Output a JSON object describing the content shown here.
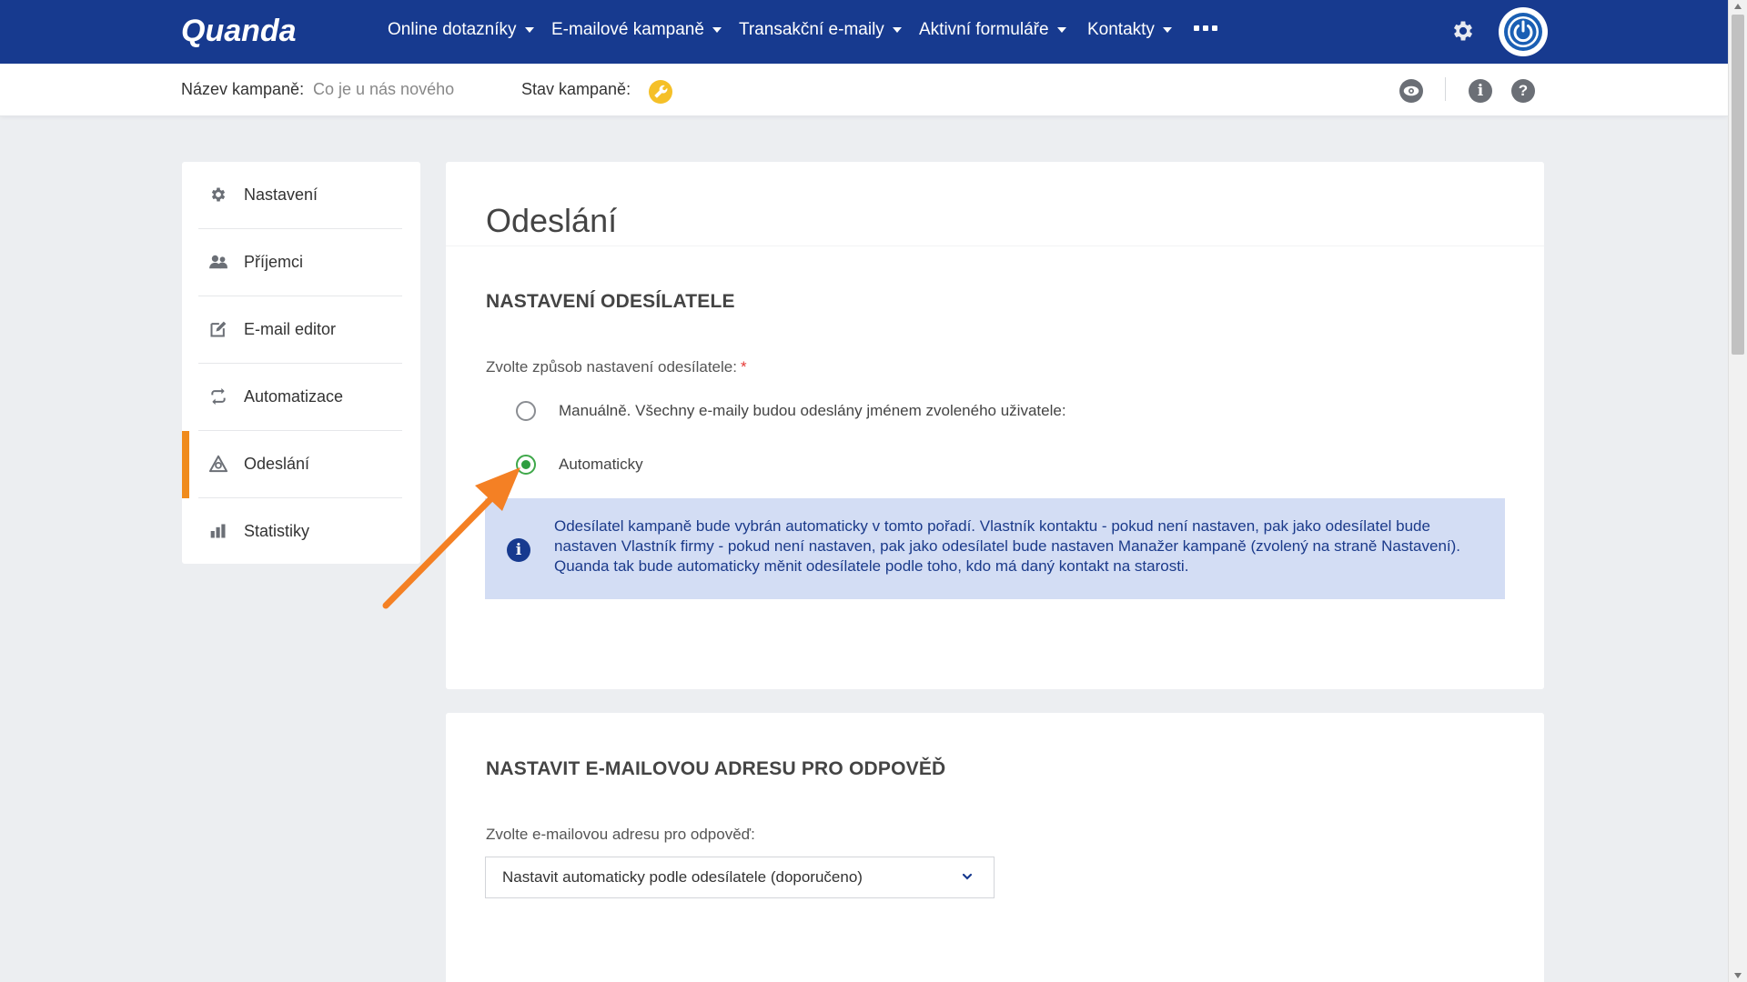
{
  "brand": {
    "logo_text": "Quanda"
  },
  "topnav": {
    "items": [
      {
        "label": "Online dotazníky"
      },
      {
        "label": "E-mailové kampaně"
      },
      {
        "label": "Transakční e-maily"
      },
      {
        "label": "Aktivní formuláře"
      },
      {
        "label": "Kontakty"
      }
    ]
  },
  "subbar": {
    "campaign_name_label": "Název kampaně:",
    "campaign_name_value": "Co je u nás nového",
    "campaign_status_label": "Stav kampaně:"
  },
  "sidebar": {
    "items": [
      {
        "label": "Nastavení",
        "icon": "gear-icon"
      },
      {
        "label": "Příjemci",
        "icon": "users-icon"
      },
      {
        "label": "E-mail editor",
        "icon": "edit-icon"
      },
      {
        "label": "Automatizace",
        "icon": "sync-icon"
      },
      {
        "label": "Odeslání",
        "icon": "send-icon",
        "active": true
      },
      {
        "label": "Statistiky",
        "icon": "bar-chart-icon"
      }
    ]
  },
  "main": {
    "page_title": "Odeslání",
    "sender_section": {
      "title": "NASTAVENÍ ODESÍLATELE",
      "field_label": "Zvolte způsob nastavení odesílatele:",
      "required_mark": "*",
      "options": [
        {
          "label": "Manuálně. Všechny e-maily budou odeslány jménem zvoleného uživatele:",
          "checked": false
        },
        {
          "label": "Automaticky",
          "checked": true
        }
      ],
      "info_text": "Odesílatel kampaně bude vybrán automaticky v tomto pořadí. Vlastník kontaktu - pokud není nastaven, pak jako odesílatel bude nastaven Vlastník firmy - pokud není nastaven, pak jako odesílatel bude nastaven Manažer kampaně (zvolený na straně Nastavení). Quanda tak bude automaticky měnit odesílatele podle toho, kdo má daný kontakt na starosti."
    },
    "reply_section": {
      "title": "NASTAVIT E-MAILOVOU ADRESU PRO ODPOVĚĎ",
      "field_label": "Zvolte e-mailovou adresu pro odpověď:",
      "select_value": "Nastavit automaticky podle odesílatele (doporučeno)"
    }
  },
  "colors": {
    "nav_bg": "#173a8f",
    "accent_orange": "#f08b1d",
    "radio_checked": "#2e9e3f",
    "info_bg": "#d3ddf4",
    "status_yellow": "#f5c028"
  }
}
